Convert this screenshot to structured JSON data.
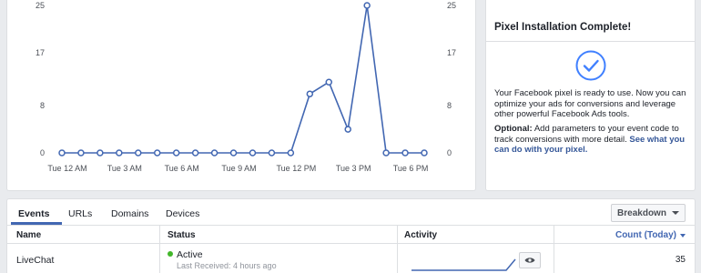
{
  "chart_data": {
    "type": "line",
    "x": [
      "Tue 12 AM",
      "",
      "",
      "Tue 3 AM",
      "",
      "",
      "Tue 6 AM",
      "",
      "",
      "Tue 9 AM",
      "",
      "",
      "Tue 12 PM",
      "",
      "",
      "Tue 3 PM",
      "",
      "",
      "Tue 6 PM",
      ""
    ],
    "xtick_labels": [
      "Tue 12 AM",
      "Tue 3 AM",
      "Tue 6 AM",
      "Tue 9 AM",
      "Tue 12 PM",
      "Tue 3 PM",
      "Tue 6 PM"
    ],
    "values": [
      0,
      0,
      0,
      0,
      0,
      0,
      0,
      0,
      0,
      0,
      0,
      0,
      0,
      10,
      12,
      4,
      25,
      0,
      0,
      0
    ],
    "yticks": [
      "25",
      "17",
      "8",
      "0"
    ],
    "ylim": [
      0,
      25
    ],
    "color": "#4267b2",
    "grid": false
  },
  "info": {
    "title": "Pixel Installation Complete!",
    "body": "Your Facebook pixel is ready to use. Now you can optimize your ads for conversions and leverage other powerful Facebook Ads tools.",
    "optional_label": "Optional:",
    "optional_text": " Add parameters to your event code to track conversions with more detail. ",
    "optional_link": "See what you can do with your pixel."
  },
  "table": {
    "tabs": [
      "Events",
      "URLs",
      "Domains",
      "Devices"
    ],
    "breakdown_label": "Breakdown",
    "headers": {
      "name": "Name",
      "status": "Status",
      "activity": "Activity",
      "count": "Count (Today)"
    },
    "rows": [
      {
        "name": "LiveChat",
        "status": "Active",
        "last_received": "Last Received: 4 hours ago",
        "count": "35"
      }
    ]
  },
  "colors": {
    "accent": "#4267b2",
    "status_active": "#42b72a"
  },
  "icons": {
    "check": "check-circle-icon",
    "eye": "eye-icon",
    "caret": "caret-down-icon"
  }
}
